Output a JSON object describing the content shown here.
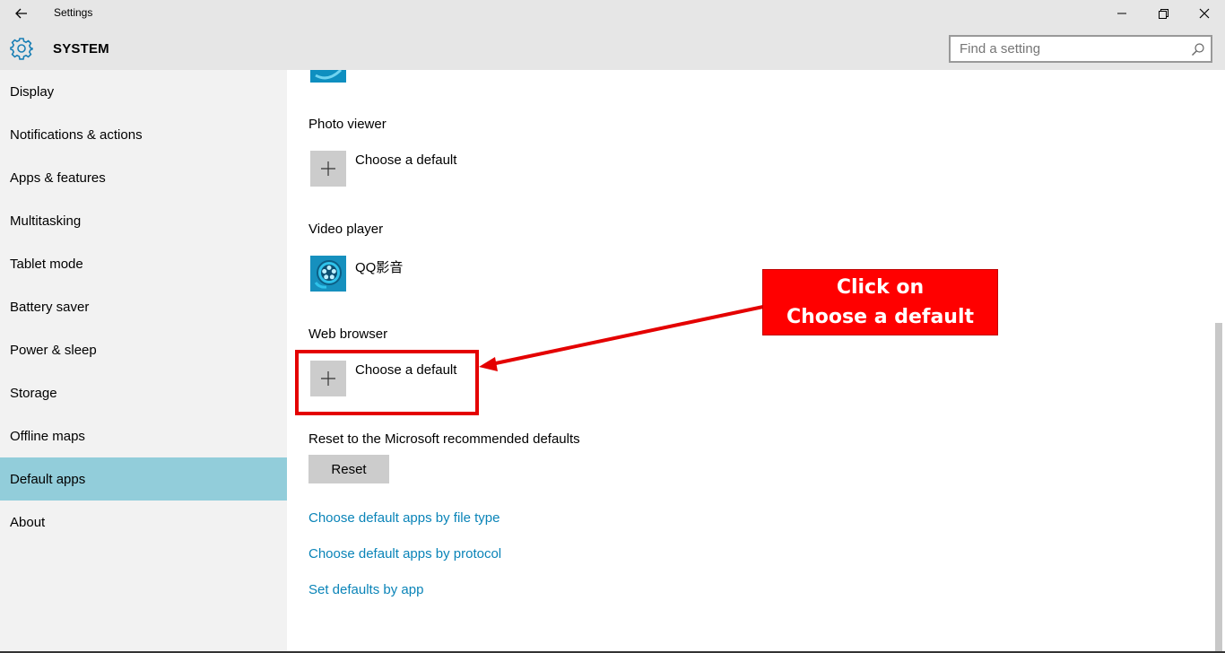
{
  "window": {
    "title": "Settings",
    "back_icon": "back-arrow-icon",
    "minimize_icon": "minimize-icon",
    "maximize_icon": "restore-icon",
    "close_icon": "close-icon"
  },
  "header": {
    "section_icon": "gear-icon",
    "section_title": "SYSTEM",
    "search": {
      "placeholder": "Find a setting",
      "value": "",
      "icon": "search-icon"
    }
  },
  "sidebar": {
    "active_color": "#92cdda",
    "items": [
      {
        "label": "Display"
      },
      {
        "label": "Notifications & actions"
      },
      {
        "label": "Apps & features"
      },
      {
        "label": "Multitasking"
      },
      {
        "label": "Tablet mode"
      },
      {
        "label": "Battery saver"
      },
      {
        "label": "Power & sleep"
      },
      {
        "label": "Storage"
      },
      {
        "label": "Offline maps"
      },
      {
        "label": "Default apps",
        "active": true
      },
      {
        "label": "About"
      }
    ]
  },
  "main": {
    "groups": [
      {
        "label": "Photo viewer",
        "app_name": "Choose a default",
        "icon": "plus-icon"
      },
      {
        "label": "Video player",
        "app_name": "QQ影音",
        "icon": "qq-player-icon"
      },
      {
        "label": "Web browser",
        "app_name": "Choose a default",
        "icon": "plus-icon"
      }
    ],
    "reset": {
      "label": "Reset to the Microsoft recommended defaults",
      "button": "Reset"
    },
    "links": [
      {
        "label": "Choose default apps by file type"
      },
      {
        "label": "Choose default apps by protocol"
      },
      {
        "label": "Set defaults by app"
      }
    ],
    "link_color": "#0a84b8"
  },
  "annotation": {
    "line1": "Click on",
    "line2": "Choose a default",
    "color": "#ff0000"
  }
}
